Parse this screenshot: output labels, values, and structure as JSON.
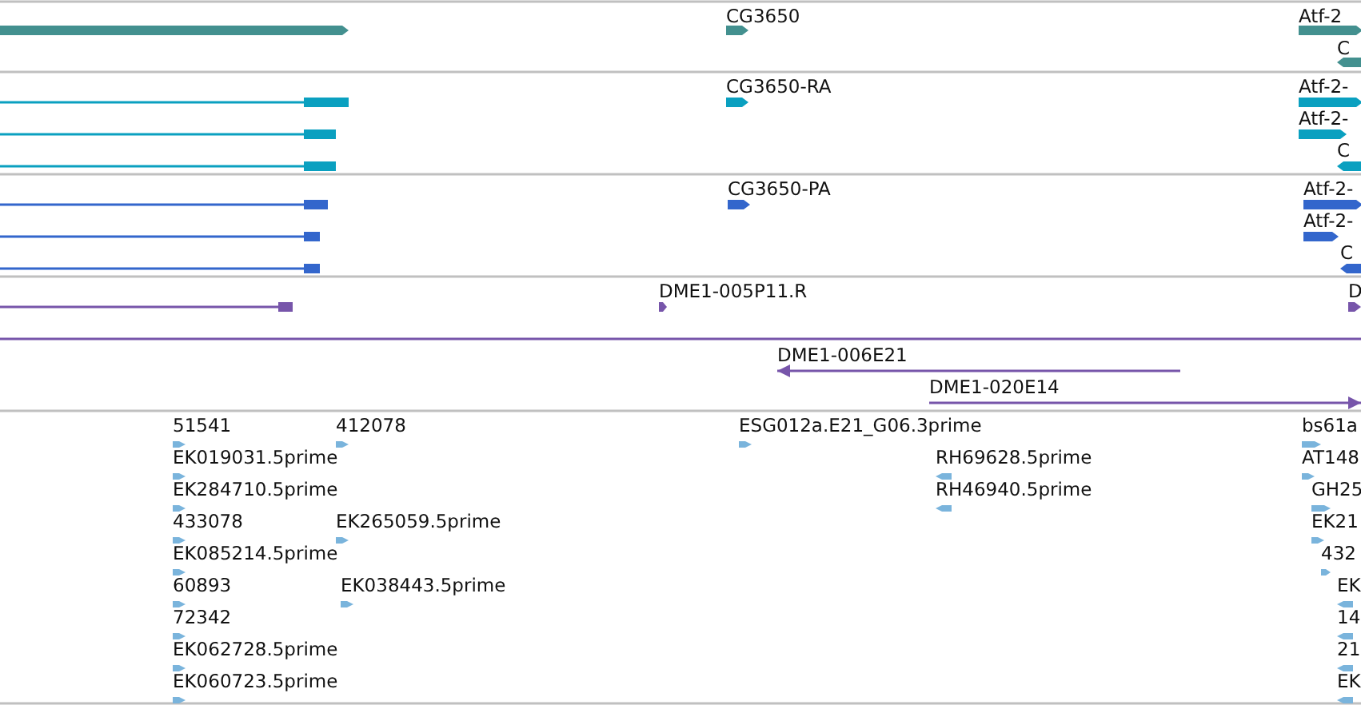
{
  "tracks": [
    {
      "kind": "gene",
      "features": [
        {
          "label": "CG3650",
          "reverse": false
        },
        {
          "label": "Atf-2",
          "reverse": false
        },
        {
          "label": "C",
          "reverse": true
        }
      ]
    },
    {
      "kind": "transcript",
      "features": [
        {
          "label": "CG3650-RA",
          "reverse": false
        },
        {
          "label": "Atf-2-",
          "reverse": false
        },
        {
          "label": "Atf-2-",
          "reverse": false
        },
        {
          "label": "C",
          "reverse": true
        }
      ]
    },
    {
      "kind": "protein",
      "features": [
        {
          "label": "CG3650-PA",
          "reverse": false
        },
        {
          "label": "Atf-2-",
          "reverse": false
        },
        {
          "label": "Atf-2-",
          "reverse": false
        },
        {
          "label": "C",
          "reverse": true
        }
      ]
    },
    {
      "kind": "clone",
      "features": [
        {
          "label": "DME1-005P11.R",
          "reverse": false
        },
        {
          "label": "D",
          "reverse": false
        },
        {
          "label": "DME1-006E21",
          "reverse": true
        },
        {
          "label": "DME1-020E14",
          "reverse": false
        }
      ]
    },
    {
      "kind": "est",
      "features": [
        {
          "label": "51541",
          "reverse": false
        },
        {
          "label": "412078",
          "reverse": false
        },
        {
          "label": "EK019031.5prime",
          "reverse": false
        },
        {
          "label": "EK284710.5prime",
          "reverse": false
        },
        {
          "label": "433078",
          "reverse": false
        },
        {
          "label": "EK265059.5prime",
          "reverse": false
        },
        {
          "label": "EK085214.5prime",
          "reverse": false
        },
        {
          "label": "60893",
          "reverse": false
        },
        {
          "label": "EK038443.5prime",
          "reverse": false
        },
        {
          "label": "72342",
          "reverse": false
        },
        {
          "label": "EK062728.5prime",
          "reverse": false
        },
        {
          "label": "EK060723.5prime",
          "reverse": false
        },
        {
          "label": "ESG012a.E21_G06.3prime",
          "reverse": false
        },
        {
          "label": "RH69628.5prime",
          "reverse": true
        },
        {
          "label": "RH46940.5prime",
          "reverse": true
        },
        {
          "label": "bs61a",
          "reverse": false
        },
        {
          "label": "AT148",
          "reverse": false
        },
        {
          "label": "GH25",
          "reverse": false
        },
        {
          "label": "EK21",
          "reverse": false
        },
        {
          "label": "432",
          "reverse": false
        },
        {
          "label": "EK",
          "reverse": true
        },
        {
          "label": "14",
          "reverse": true
        },
        {
          "label": "21",
          "reverse": true
        },
        {
          "label": "EK",
          "reverse": true
        }
      ]
    }
  ]
}
